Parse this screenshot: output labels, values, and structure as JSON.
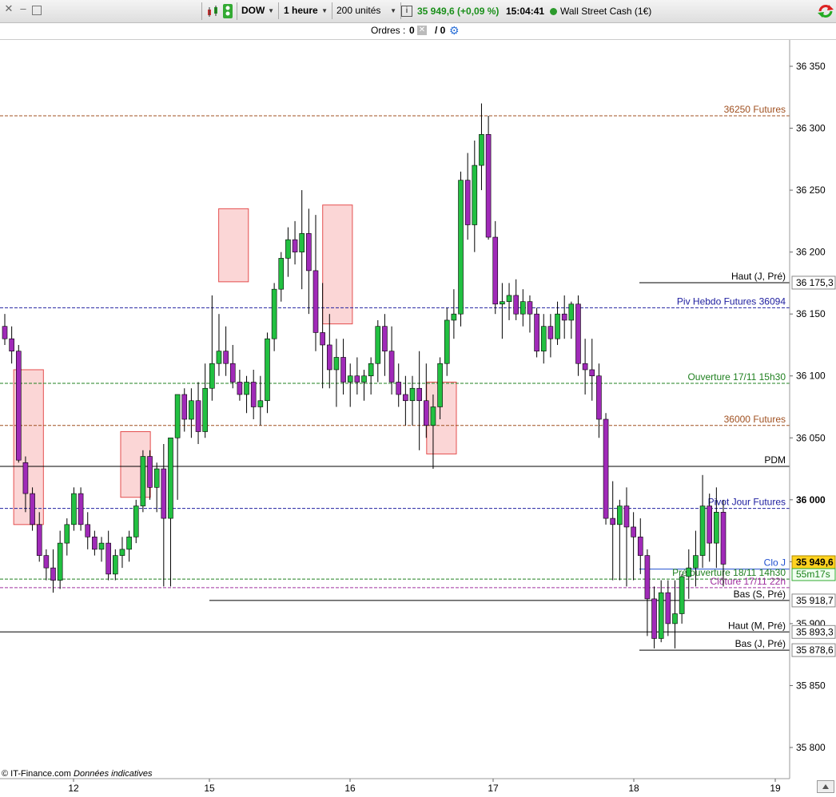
{
  "toolbar": {
    "symbol": "DOW",
    "timeframe": "1 heure",
    "units": "200 unités",
    "price_change": "35 949,6 (+0,09 %)",
    "time": "15:04:41",
    "instrument": "Wall Street Cash (1€)"
  },
  "orders": {
    "label": "Ordres :",
    "count1": "0",
    "count2": "/ 0"
  },
  "footer": {
    "copyright": "© IT-Finance.com",
    "note": "Données indicatives"
  },
  "colors": {
    "bull": "#22c041",
    "bear": "#a02ab8",
    "zone_fill": "#fbd0d0",
    "zone_stroke": "#e03030"
  },
  "chart_data": {
    "type": "candlestick",
    "y_ticks": [
      "36 350",
      "36 300",
      "36 250",
      "36 200",
      "36 150",
      "36 100",
      "36 050",
      "36 000",
      "35 950",
      "35 900",
      "35 850",
      "35 800"
    ],
    "y_tick_values": [
      36350,
      36300,
      36250,
      36200,
      36150,
      36100,
      36050,
      36000,
      35950,
      35900,
      35850,
      35800
    ],
    "ylim": [
      35770,
      36390
    ],
    "x_labels": [
      "12",
      "15",
      "16",
      "17",
      "18",
      "19"
    ],
    "levels": [
      {
        "label": "36250 Futures",
        "value": 36310,
        "color": "#a05020",
        "style": "dash"
      },
      {
        "label": "Haut (J, Pré)",
        "value": 36175.3,
        "color": "#000000",
        "style": "solid",
        "tag": "36 175,3",
        "partial": true
      },
      {
        "label": "Piv Hebdo Futures 36094",
        "value": 36155,
        "color": "#2020a0",
        "style": "dash"
      },
      {
        "label": "Ouverture 17/11 15h30",
        "value": 36094,
        "color": "#208020",
        "style": "dash"
      },
      {
        "label": "36000 Futures",
        "value": 36060,
        "color": "#a05020",
        "style": "dash"
      },
      {
        "label": "PDM",
        "value": 36027,
        "color": "#000000",
        "style": "solid"
      },
      {
        "label": "Pivot Jour Futures",
        "value": 35993,
        "color": "#2020a0",
        "style": "dash"
      },
      {
        "label": "Clo J",
        "value": 35944,
        "color": "#2050d0",
        "style": "solid",
        "partial": true
      },
      {
        "label": "Pré ouverture 18/11 14h30",
        "value": 35936,
        "color": "#208020",
        "style": "dash"
      },
      {
        "label": "Clôture 17/11 22h",
        "value": 35929,
        "color": "#a030a0",
        "style": "dash"
      },
      {
        "label": "Bas (S, Pré)",
        "value": 35918.7,
        "color": "#000000",
        "style": "solid",
        "tag": "35 918,7",
        "partial": true
      },
      {
        "label": "Haut (M, Pré)",
        "value": 35893.3,
        "color": "#000000",
        "style": "solid",
        "tag": "35 893,3"
      },
      {
        "label": "Bas (J, Pré)",
        "value": 35878.6,
        "color": "#000000",
        "style": "solid",
        "tag": "35 878,6",
        "partial": true
      }
    ],
    "current_price": "35 949,6",
    "countdown": "55m17s",
    "zones": [
      {
        "x_from": 0.3,
        "x_to": 1.3,
        "y_top": 36105,
        "y_bottom": 35980
      },
      {
        "x_from": 3.9,
        "x_to": 4.9,
        "y_top": 36055,
        "y_bottom": 36002
      },
      {
        "x_from": 7.2,
        "x_to": 8.2,
        "y_top": 36235,
        "y_bottom": 36176
      },
      {
        "x_from": 10.7,
        "x_to": 11.7,
        "y_top": 36238,
        "y_bottom": 36142
      },
      {
        "x_from": 14.2,
        "x_to": 15.2,
        "y_top": 36095,
        "y_bottom": 36037
      }
    ],
    "candles": [
      [
        36140,
        36150,
        36125,
        36130
      ],
      [
        36130,
        36140,
        36110,
        36120
      ],
      [
        36120,
        36125,
        36030,
        36032
      ],
      [
        36030,
        36035,
        35990,
        36005
      ],
      [
        36005,
        36010,
        35975,
        35980
      ],
      [
        35980,
        35990,
        35950,
        35955
      ],
      [
        35955,
        35960,
        35935,
        35945
      ],
      [
        35945,
        35960,
        35925,
        35935
      ],
      [
        35935,
        35975,
        35928,
        35965
      ],
      [
        35965,
        35985,
        35955,
        35980
      ],
      [
        35980,
        36010,
        35975,
        36005
      ],
      [
        36005,
        36010,
        35975,
        35980
      ],
      [
        35980,
        35990,
        35960,
        35970
      ],
      [
        35970,
        35975,
        35955,
        35960
      ],
      [
        35960,
        35970,
        35950,
        35965
      ],
      [
        35965,
        35975,
        35935,
        35940
      ],
      [
        35940,
        35960,
        35935,
        35955
      ],
      [
        35955,
        35970,
        35945,
        35960
      ],
      [
        35960,
        35975,
        35950,
        35970
      ],
      [
        35970,
        36000,
        35965,
        35995
      ],
      [
        35995,
        36040,
        35990,
        36035
      ],
      [
        36035,
        36040,
        36000,
        36010
      ],
      [
        36010,
        36030,
        35990,
        36025
      ],
      [
        36025,
        36045,
        35930,
        35985
      ],
      [
        35985,
        36035,
        35930,
        36050
      ],
      [
        36050,
        36085,
        36000,
        36085
      ],
      [
        36085,
        36090,
        36055,
        36065
      ],
      [
        36065,
        36090,
        36050,
        36080
      ],
      [
        36080,
        36095,
        36045,
        36055
      ],
      [
        36055,
        36110,
        36050,
        36090
      ],
      [
        36090,
        36165,
        36080,
        36110
      ],
      [
        36110,
        36150,
        36100,
        36120
      ],
      [
        36120,
        36140,
        36100,
        36110
      ],
      [
        36110,
        36125,
        36090,
        36095
      ],
      [
        36095,
        36105,
        36080,
        36085
      ],
      [
        36085,
        36100,
        36070,
        36095
      ],
      [
        36095,
        36105,
        36065,
        36075
      ],
      [
        36075,
        36100,
        36060,
        36080
      ],
      [
        36080,
        36135,
        36070,
        36130
      ],
      [
        36130,
        36175,
        36120,
        36170
      ],
      [
        36170,
        36200,
        36160,
        36195
      ],
      [
        36195,
        36220,
        36180,
        36210
      ],
      [
        36210,
        36225,
        36190,
        36200
      ],
      [
        36200,
        36250,
        36170,
        36215
      ],
      [
        36215,
        36235,
        36150,
        36185
      ],
      [
        36185,
        36230,
        36120,
        36135
      ],
      [
        36135,
        36175,
        36090,
        36125
      ],
      [
        36125,
        36150,
        36090,
        36105
      ],
      [
        36105,
        36130,
        36075,
        36115
      ],
      [
        36115,
        36130,
        36085,
        36095
      ],
      [
        36095,
        36110,
        36075,
        36100
      ],
      [
        36100,
        36115,
        36085,
        36095
      ],
      [
        36095,
        36105,
        36080,
        36100
      ],
      [
        36100,
        36115,
        36085,
        36110
      ],
      [
        36110,
        36145,
        36095,
        36140
      ],
      [
        36140,
        36150,
        36100,
        36120
      ],
      [
        36120,
        36140,
        36085,
        36095
      ],
      [
        36095,
        36110,
        36075,
        36085
      ],
      [
        36085,
        36100,
        36060,
        36080
      ],
      [
        36080,
        36100,
        36060,
        36090
      ],
      [
        36090,
        36120,
        36040,
        36080
      ],
      [
        36080,
        36110,
        36050,
        36060
      ],
      [
        36060,
        36085,
        36025,
        36075
      ],
      [
        36075,
        36115,
        36065,
        36110
      ],
      [
        36110,
        36155,
        36100,
        36145
      ],
      [
        36145,
        36170,
        36130,
        36150
      ],
      [
        36150,
        36265,
        36140,
        36258
      ],
      [
        36258,
        36280,
        36210,
        36222
      ],
      [
        36222,
        36290,
        36200,
        36270
      ],
      [
        36270,
        36320,
        36250,
        36295
      ],
      [
        36295,
        36310,
        36210,
        36212
      ],
      [
        36212,
        36225,
        36150,
        36158
      ],
      [
        36158,
        36175,
        36130,
        36160
      ],
      [
        36160,
        36175,
        36145,
        36165
      ],
      [
        36165,
        36178,
        36145,
        36150
      ],
      [
        36150,
        36170,
        36140,
        36160
      ],
      [
        36160,
        36165,
        36135,
        36150
      ],
      [
        36150,
        36155,
        36115,
        36120
      ],
      [
        36120,
        36150,
        36110,
        36140
      ],
      [
        36140,
        36150,
        36115,
        36130
      ],
      [
        36130,
        36160,
        36125,
        36150
      ],
      [
        36150,
        36165,
        36130,
        36145
      ],
      [
        36145,
        36160,
        36130,
        36158
      ],
      [
        36158,
        36165,
        36100,
        36110
      ],
      [
        36110,
        36130,
        36085,
        36105
      ],
      [
        36105,
        36130,
        36080,
        36100
      ],
      [
        36100,
        36110,
        36050,
        36065
      ],
      [
        36065,
        36070,
        35980,
        35985
      ],
      [
        35985,
        36015,
        35935,
        35980
      ],
      [
        35980,
        36000,
        35935,
        35995
      ],
      [
        35995,
        36010,
        35930,
        35978
      ],
      [
        35978,
        35990,
        35935,
        35970
      ],
      [
        35970,
        35985,
        35940,
        35955
      ],
      [
        35955,
        35960,
        35890,
        35920
      ],
      [
        35920,
        35930,
        35880,
        35888
      ],
      [
        35888,
        35935,
        35885,
        35925
      ],
      [
        35925,
        35935,
        35890,
        35900
      ],
      [
        35900,
        35935,
        35880,
        35908
      ],
      [
        35908,
        35940,
        35900,
        35938
      ],
      [
        35938,
        35960,
        35920,
        35945
      ],
      [
        35945,
        35975,
        35930,
        35955
      ],
      [
        35955,
        36020,
        35945,
        35995
      ],
      [
        35995,
        36005,
        35950,
        35965
      ],
      [
        35965,
        36010,
        35945,
        35990
      ],
      [
        35990,
        36000,
        35930,
        35948
      ]
    ]
  }
}
